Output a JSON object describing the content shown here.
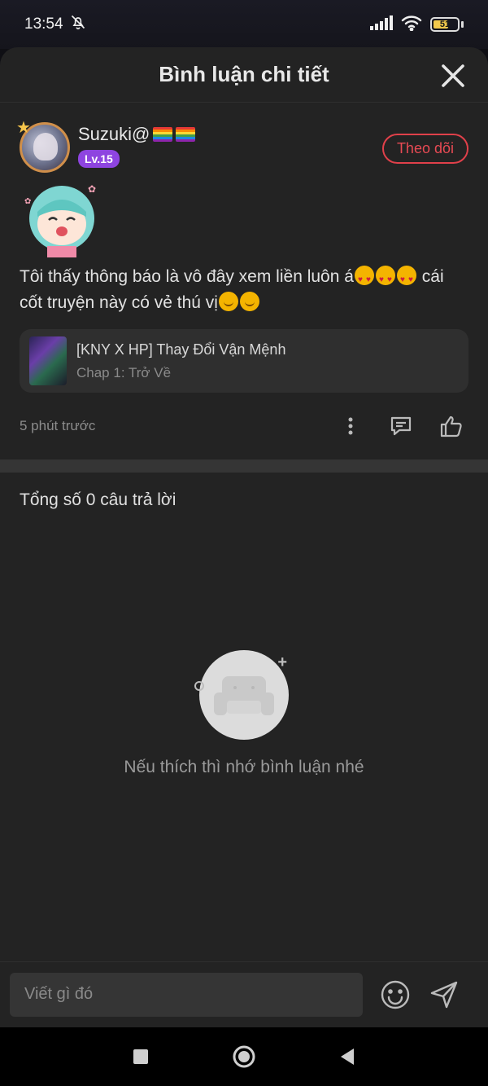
{
  "status_bar": {
    "time": "13:54",
    "battery": "51",
    "icons": [
      "bell-off-icon",
      "signal-icon",
      "wifi-icon",
      "battery-icon"
    ]
  },
  "header": {
    "title": "Bình luận chi tiết",
    "close_icon": "close-icon"
  },
  "comment": {
    "username": "Suzuki@",
    "level": "Lv.15",
    "follow_label": "Theo dõi",
    "text_part1": "Tôi thấy thông báo là vô đây xem liền luôn á",
    "text_part2": " cái cốt truyện này có vẻ thú vị",
    "story": {
      "title": "[KNY X HP] Thay Đổi Vận Mệnh",
      "chapter": "Chap 1: Trở Về"
    },
    "time": "5 phút trước",
    "action_icons": [
      "more-vertical-icon",
      "reply-comment-icon",
      "thumbs-up-icon"
    ]
  },
  "replies": {
    "total_label": "Tổng số 0 câu trả lời",
    "empty_text": "Nếu thích thì nhớ bình luận nhé"
  },
  "input": {
    "placeholder": "Viết gì đó"
  },
  "colors": {
    "accent_red": "#e0404a",
    "level_purple": "#8e44e0",
    "sheet_bg": "#232323"
  }
}
